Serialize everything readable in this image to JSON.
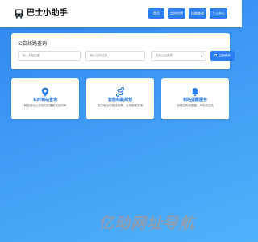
{
  "header": {
    "app_title": "巴士小助手",
    "logo_icon": "bus-icon",
    "nav": [
      "首页",
      "实时位置",
      "线路查询",
      "个人中心"
    ]
  },
  "search": {
    "title": "公交线路查询",
    "from_placeholder": "输入出发位置",
    "to_placeholder": "输入目的位置",
    "type_value": "选择公交类型",
    "button_label": "立即查询"
  },
  "features": [
    {
      "icon": "location-pin-icon",
      "title": "实时到站查询",
      "desc": "精准到站公交实时位置和到站时间"
    },
    {
      "icon": "route-icon",
      "title": "智能线路规划",
      "desc": "多方案出行路线推荐，支持换乘查询"
    },
    {
      "icon": "bell-icon",
      "title": "到站提醒服务",
      "desc": "设置目的地提醒，不怕坐过站"
    }
  ],
  "colors": {
    "accent": "#2b7ff0",
    "feature_title": "#1f6fd8"
  },
  "watermark": "亿动网址导航"
}
